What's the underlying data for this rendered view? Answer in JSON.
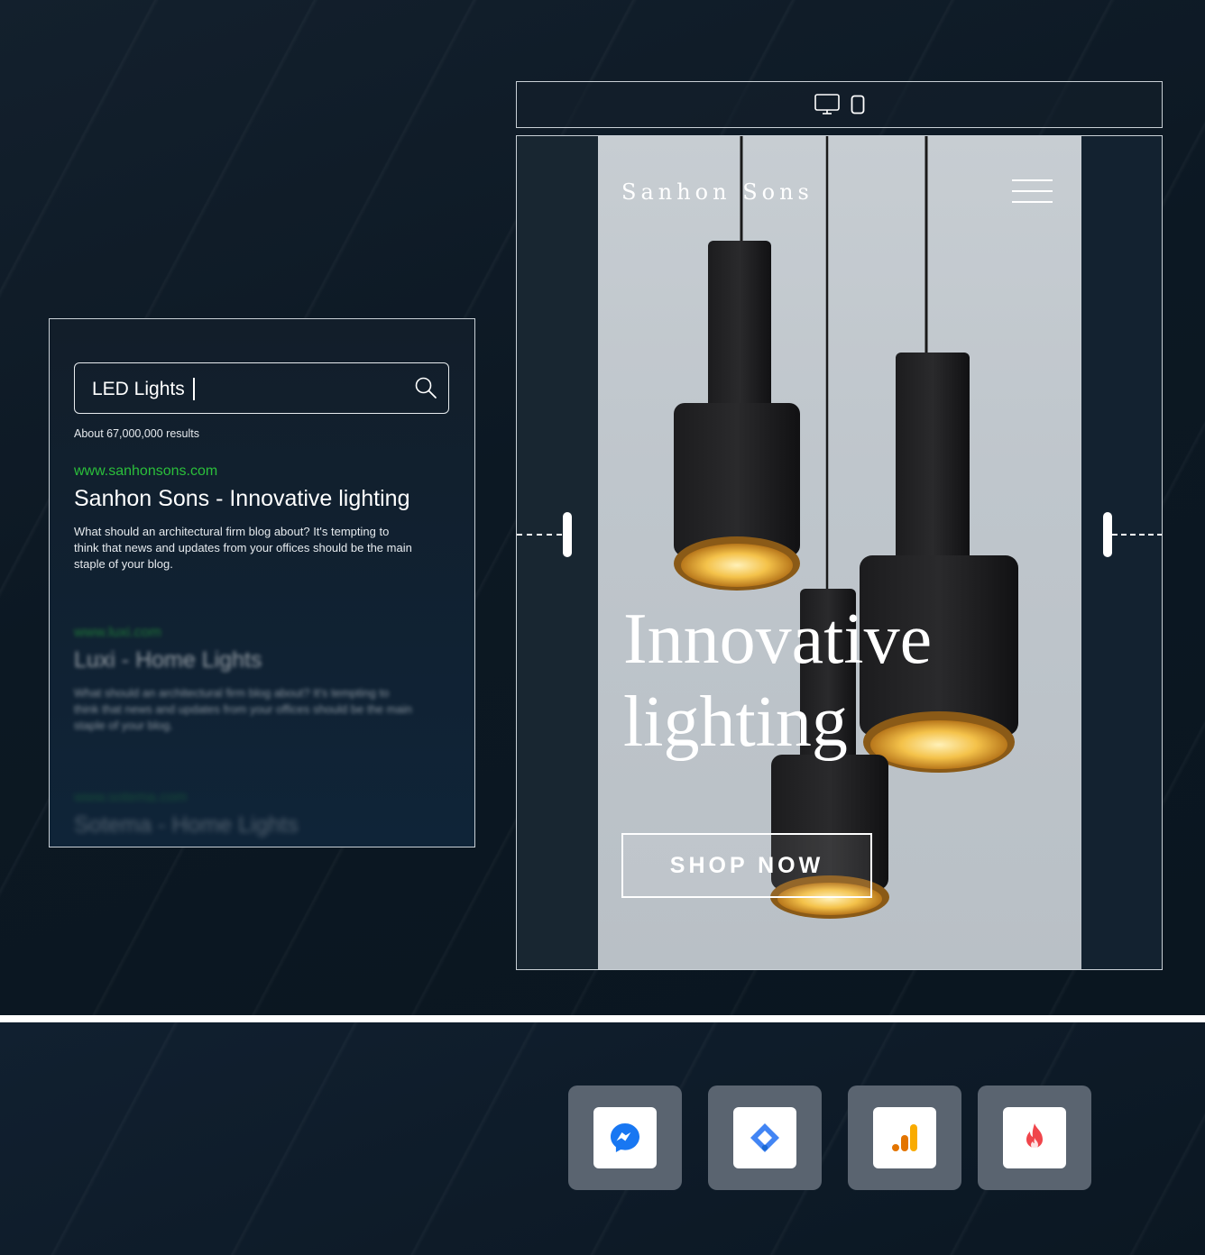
{
  "search": {
    "query": "LED Lights",
    "result_count": "About 67,000,000 results",
    "results": [
      {
        "url": "www.sanhonsons.com",
        "title": "Sanhon Sons - Innovative lighting",
        "description": "What should an architectural firm blog about? It's tempting to think that news and updates from your offices should be the main staple of your blog."
      },
      {
        "url": "www.luxi.com",
        "title": "Luxi - Home Lights",
        "description": "What should an architectural firm blog about? It's tempting to think that news and updates from your offices should be the main staple of your blog."
      },
      {
        "url": "www.sotema.com",
        "title": "Sotema - Home Lights"
      }
    ]
  },
  "device_toolbar": {
    "icons": [
      "desktop-icon",
      "mobile-icon"
    ]
  },
  "preview": {
    "brand": "Sanhon Sons",
    "hero_line1": "Innovative",
    "hero_line2": "lighting",
    "cta_label": "SHOP NOW"
  },
  "integrations": [
    {
      "icon": "messenger-icon",
      "color": "#1877f2"
    },
    {
      "icon": "google-tag-manager-icon",
      "color": "#4285f4"
    },
    {
      "icon": "google-analytics-icon",
      "color": "#f9ab00"
    },
    {
      "icon": "firebase-flame-icon",
      "color": "#f0454b"
    }
  ]
}
